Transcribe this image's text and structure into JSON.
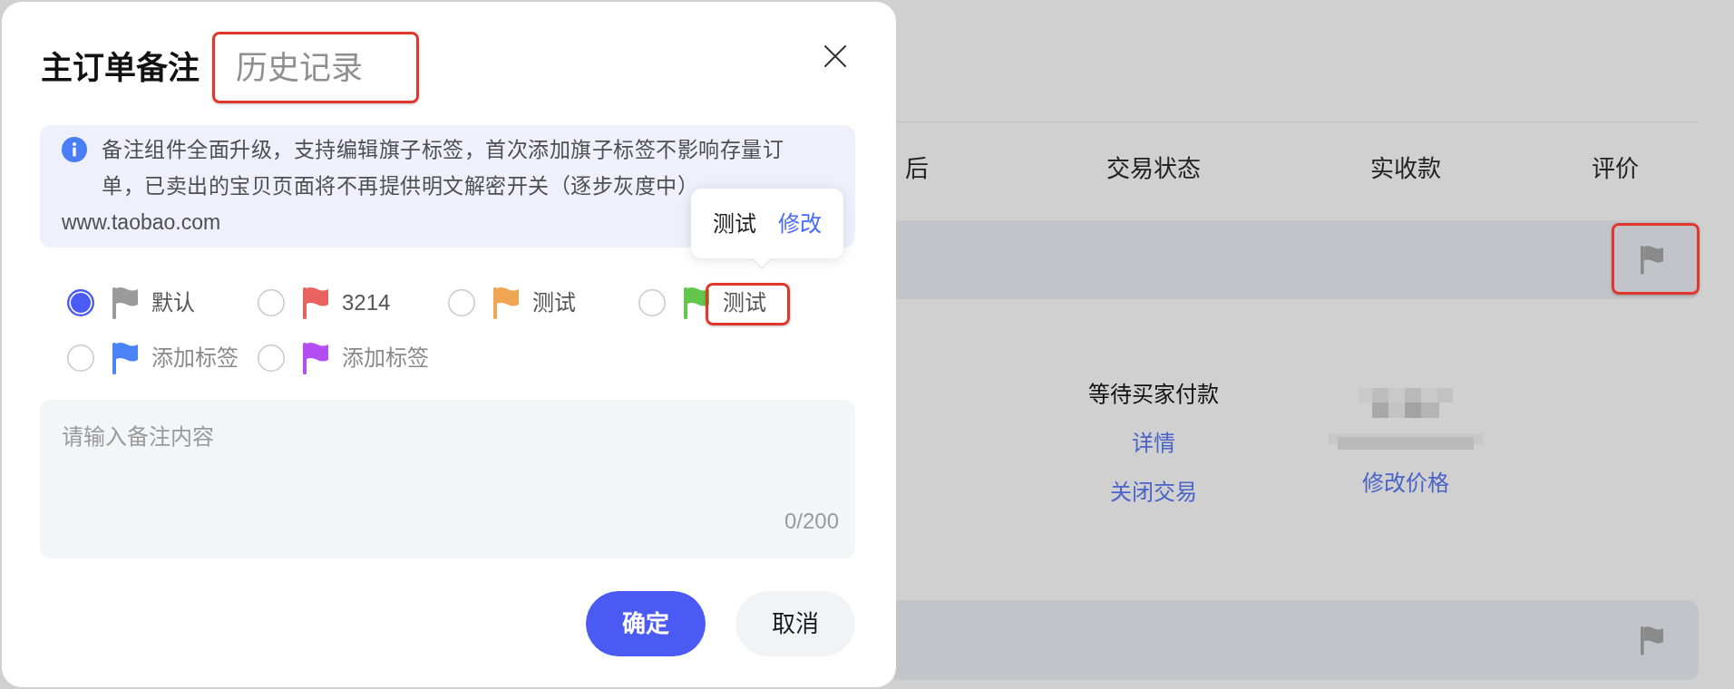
{
  "dialog": {
    "title": "主订单备注",
    "history_tab": {
      "label": "历史记录",
      "annotated": true
    },
    "notice": {
      "text": "备注组件全面升级，支持编辑旗子标签，首次添加旗子标签不影响存量订单，已卖出的宝贝页面将不再提供明文解密开关（逐步灰度中）",
      "url": "www.taobao.com"
    },
    "tags": [
      {
        "label": "默认",
        "kind": "named",
        "color": "#9b9b9b",
        "selected": true,
        "annotated": false
      },
      {
        "label": "3214",
        "kind": "named",
        "color": "#e8625f",
        "selected": false,
        "annotated": false
      },
      {
        "label": "测试",
        "kind": "named",
        "color": "#f0a553",
        "selected": false,
        "annotated": false
      },
      {
        "label": "测试",
        "kind": "named",
        "color": "#63c74d",
        "selected": false,
        "annotated": true,
        "tooltip": {
          "text": "测试",
          "action": "修改"
        }
      },
      {
        "label": "添加标签",
        "kind": "empty",
        "color": "#4b84f6",
        "selected": false,
        "annotated": false
      },
      {
        "label": "添加标签",
        "kind": "empty",
        "color": "#b24ef2",
        "selected": false,
        "annotated": false
      }
    ],
    "note_field": {
      "placeholder": "请输入备注内容",
      "counter": "0/200"
    },
    "buttons": [
      {
        "label": "确定",
        "kind": "primary"
      },
      {
        "label": "取消",
        "kind": "secondary"
      }
    ]
  },
  "order_list": {
    "columns": [
      "后",
      "交易状态",
      "实收款",
      "评价"
    ],
    "orders": [
      {
        "flag_annotated": true,
        "status": "等待买家付款",
        "status_links": [
          "详情",
          "关闭交易"
        ],
        "price_link": "修改价格"
      },
      {
        "flag_annotated": false
      }
    ]
  }
}
